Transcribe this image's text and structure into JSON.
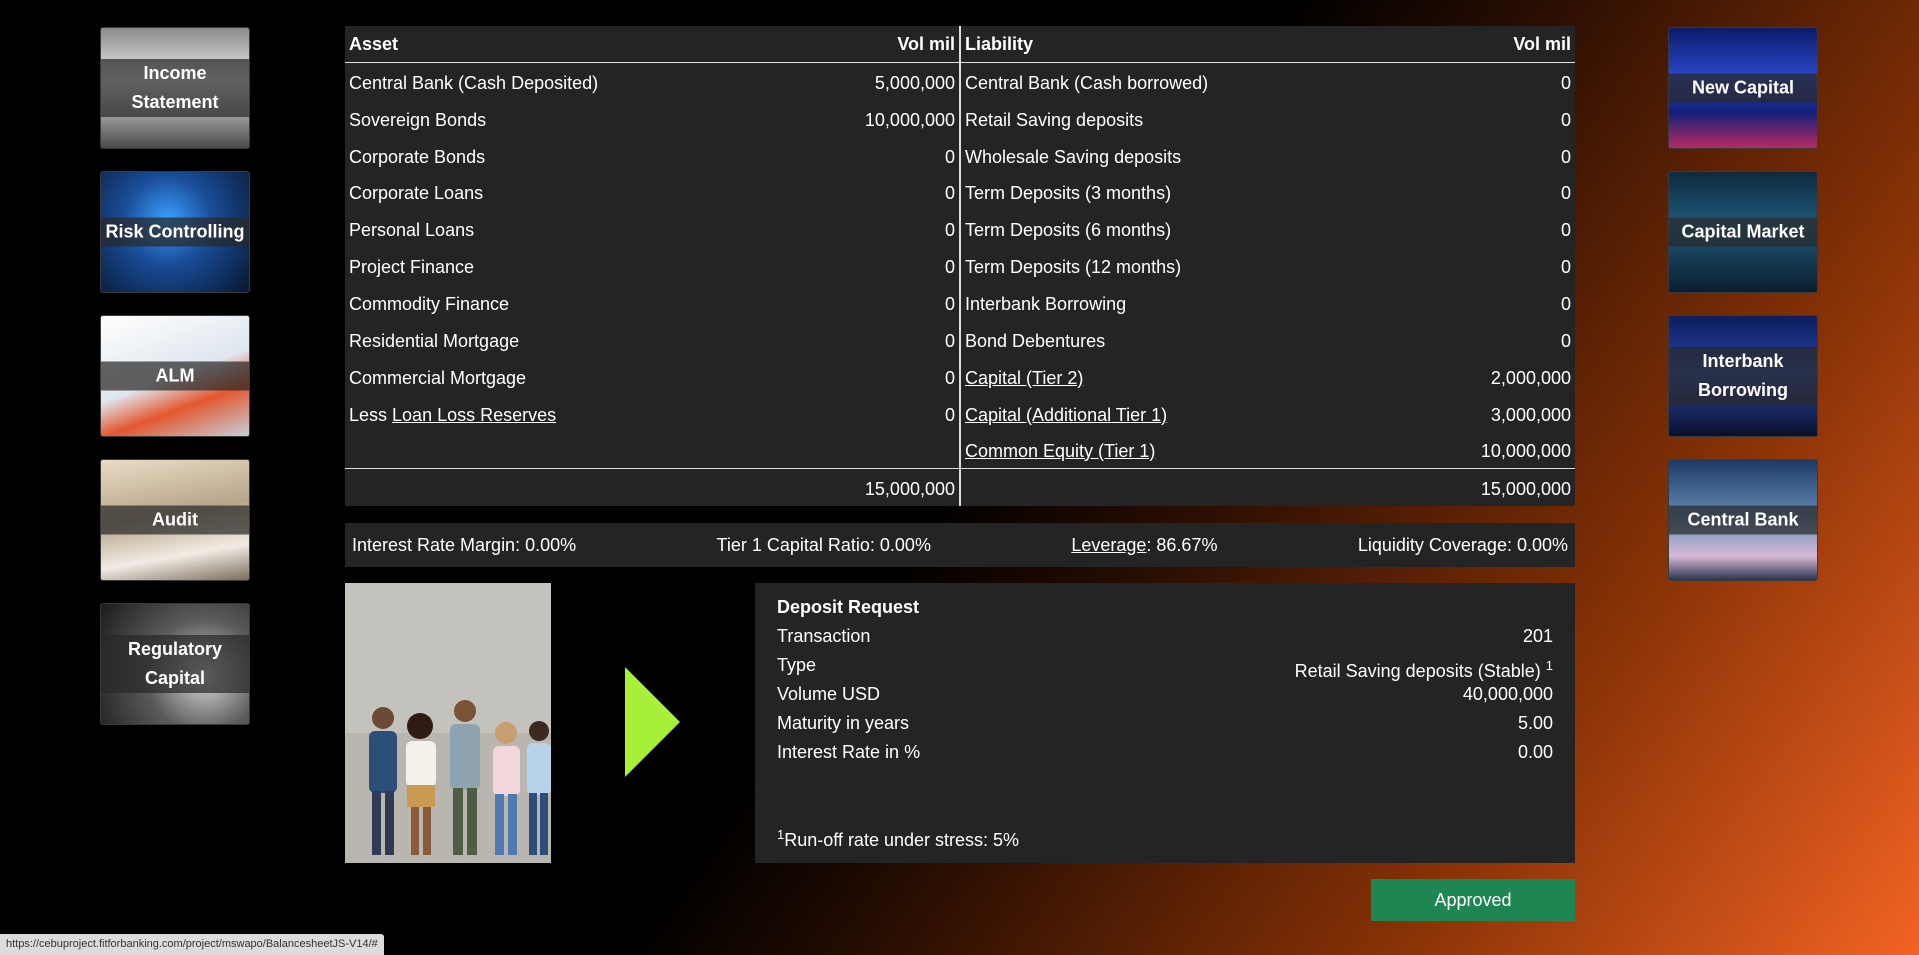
{
  "left_nav": [
    {
      "label": "Income Statement"
    },
    {
      "label": "Risk Controlling"
    },
    {
      "label": "ALM"
    },
    {
      "label": "Audit"
    },
    {
      "label": "Regulatory Capital"
    }
  ],
  "right_nav": [
    {
      "label": "New Capital"
    },
    {
      "label": "Capital Market"
    },
    {
      "label": "Interbank Borrowing"
    },
    {
      "label": "Central Bank"
    }
  ],
  "balance_sheet": {
    "asset_header": "Asset",
    "asset_vol_header": "Vol mil",
    "liability_header": "Liability",
    "liability_vol_header": "Vol mil",
    "assets": [
      {
        "label": "Central Bank (Cash Deposited)",
        "value": "5,000,000"
      },
      {
        "label": "Sovereign Bonds",
        "value": "10,000,000"
      },
      {
        "label": "Corporate Bonds",
        "value": "0"
      },
      {
        "label": "Corporate Loans",
        "value": "0"
      },
      {
        "label": "Personal Loans",
        "value": "0"
      },
      {
        "label": "Project Finance",
        "value": "0"
      },
      {
        "label": "Commodity Finance",
        "value": "0"
      },
      {
        "label": "Residential Mortgage",
        "value": "0"
      },
      {
        "label": "Commercial Mortgage",
        "value": "0"
      }
    ],
    "loss_reserve": {
      "prefix": "Less ",
      "link": "Loan Loss Reserves",
      "value": "0"
    },
    "liabilities": [
      {
        "label": "Central Bank (Cash borrowed)",
        "value": "0"
      },
      {
        "label": "Retail Saving deposits",
        "value": "0"
      },
      {
        "label": "Wholesale Saving deposits",
        "value": "0"
      },
      {
        "label": "Term Deposits (3 months)",
        "value": "0"
      },
      {
        "label": "Term Deposits (6 months)",
        "value": "0"
      },
      {
        "label": "Term Deposits (12 months)",
        "value": "0"
      },
      {
        "label": "Interbank Borrowing",
        "value": "0"
      },
      {
        "label": "Bond Debentures",
        "value": "0"
      }
    ],
    "capital": [
      {
        "label": "Capital (Tier 2)",
        "value": "2,000,000"
      },
      {
        "label": "Capital (Additional Tier 1)",
        "value": "3,000,000"
      },
      {
        "label": "Common Equity (Tier 1)",
        "value": "10,000,000"
      }
    ],
    "asset_total": "15,000,000",
    "liability_total": "15,000,000"
  },
  "metrics": {
    "interest_rate_margin": "Interest Rate Margin: 0.00%",
    "tier1_capital_ratio": "Tier 1 Capital Ratio: 0.00%",
    "leverage_link": "Leverage",
    "leverage_value": ": 86.67%",
    "liquidity_coverage": "Liquidity Coverage: 0.00%"
  },
  "deposit_request": {
    "title": "Deposit Request",
    "rows": [
      {
        "label": "Transaction",
        "value": "201"
      },
      {
        "label": "Type",
        "value": "Retail Saving deposits (Stable)",
        "sup": "1"
      },
      {
        "label": "Volume USD",
        "value": "40,000,000"
      },
      {
        "label": "Maturity in years",
        "value": "5.00"
      },
      {
        "label": "Interest Rate in %",
        "value": "0.00"
      }
    ],
    "footnote_mark": "1",
    "footnote": "Run-off rate under stress: 5%"
  },
  "approved_button": "Approved",
  "status_url": "https://cebuproject.fitforbanking.com/project/mswapo/BalancesheetJS-V14/#",
  "colors": {
    "accent_arrow": "#a6f03a",
    "approved_green": "#1e8652",
    "panel": "#242424"
  }
}
